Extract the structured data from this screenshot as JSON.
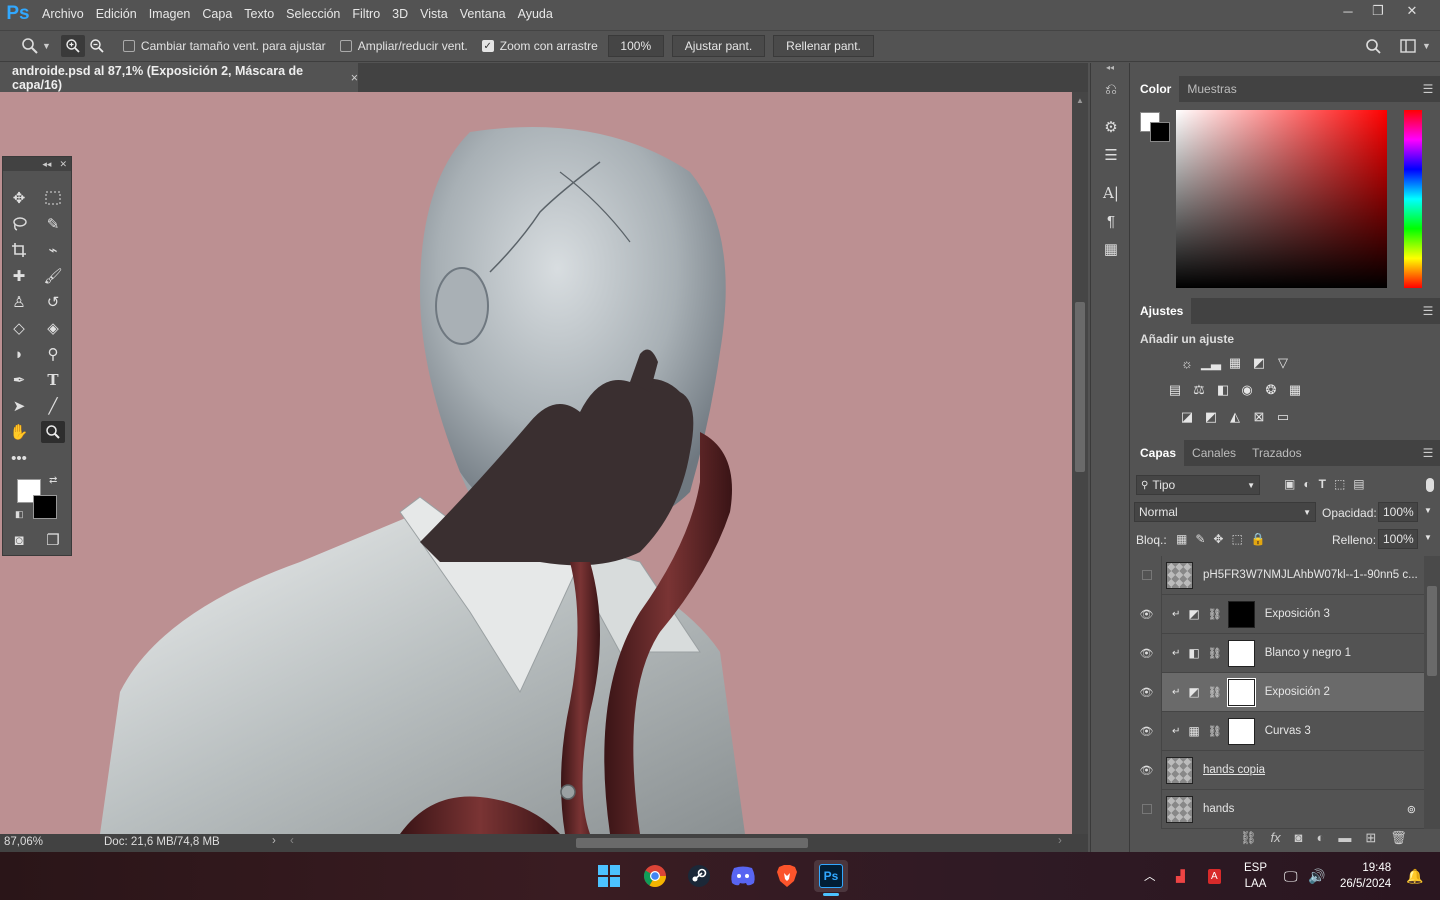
{
  "app": {
    "logo": "Ps"
  },
  "menu": [
    "Archivo",
    "Edición",
    "Imagen",
    "Capa",
    "Texto",
    "Selección",
    "Filtro",
    "3D",
    "Vista",
    "Ventana",
    "Ayuda"
  ],
  "window_controls": {
    "minimize": "─",
    "restore": "❐",
    "close": "✕"
  },
  "options": {
    "resize_windows": "Cambiar tamaño vent. para ajustar",
    "zoom_all": "Ampliar/reducir vent.",
    "scrubby_zoom": "Zoom con arrastre",
    "zoom_value": "100%",
    "fit_screen": "Ajustar pant.",
    "fill_screen": "Rellenar pant."
  },
  "document": {
    "tab_title": "androide.psd al 87,1% (Exposición 2, Máscara de capa/16)",
    "close": "×"
  },
  "status": {
    "zoom": "87,06%",
    "doc": "Doc: 21,6 MB/74,8 MB"
  },
  "color_panel": {
    "tabs": [
      "Color",
      "Muestras"
    ],
    "foreground": "#ffffff",
    "background": "#000000",
    "hue": "#ff0000"
  },
  "adjustments": {
    "tab": "Ajustes",
    "title": "Añadir un ajuste"
  },
  "layers_panel": {
    "tabs": [
      "Capas",
      "Canales",
      "Trazados"
    ],
    "filter": "Tipo",
    "blend_mode": "Normal",
    "opacity_label": "Opacidad:",
    "opacity": "100%",
    "lock_label": "Bloq.:",
    "fill_label": "Relleno:",
    "fill": "100%",
    "layers": [
      {
        "name": "pH5FR3W7NMJLAhbW07kl--1--90nn5 c...",
        "visible": false
      },
      {
        "name": "Exposición 3",
        "visible": true
      },
      {
        "name": "Blanco y negro 1",
        "visible": true
      },
      {
        "name": "Exposición 2",
        "visible": true,
        "selected": true
      },
      {
        "name": "Curvas 3",
        "visible": true
      },
      {
        "name": "hands copia",
        "visible": true
      },
      {
        "name": "hands",
        "visible": false
      }
    ]
  },
  "tray": {
    "lang1": "ESP",
    "lang2": "LAA",
    "time": "19:48",
    "date": "26/5/2024"
  }
}
